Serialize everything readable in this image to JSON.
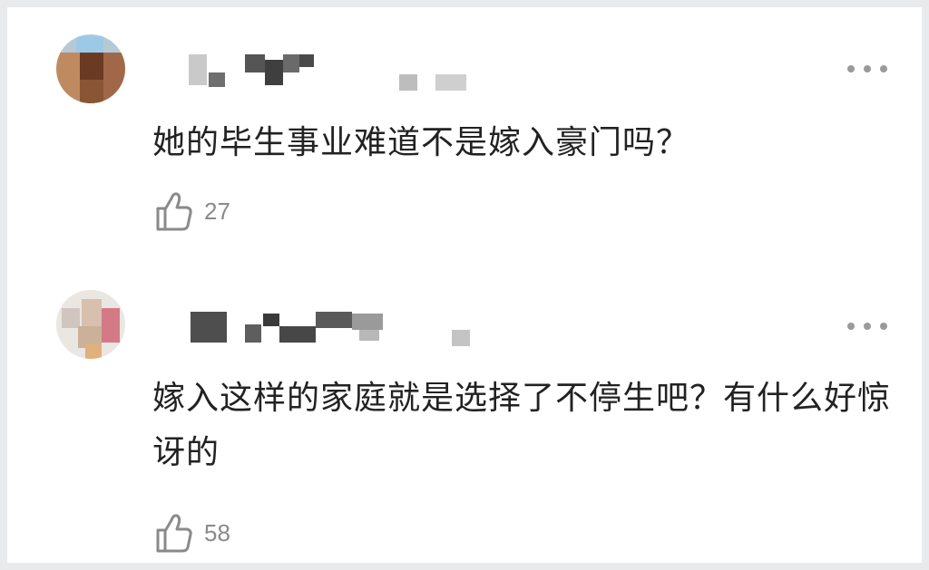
{
  "comments": [
    {
      "text": "她的毕生事业难道不是嫁入豪门吗？",
      "likes": "27",
      "like_icon": "thumbs-up-icon",
      "more_icon": "more-dots-icon"
    },
    {
      "text": "嫁入这样的家庭就是选择了不停生吧？有什么好惊讶的",
      "likes": "58",
      "like_icon": "thumbs-up-icon",
      "more_icon": "more-dots-icon"
    }
  ],
  "colors": {
    "background": "#e9eaec",
    "card": "#ffffff",
    "text": "#222222",
    "muted": "#8a8a8a"
  }
}
